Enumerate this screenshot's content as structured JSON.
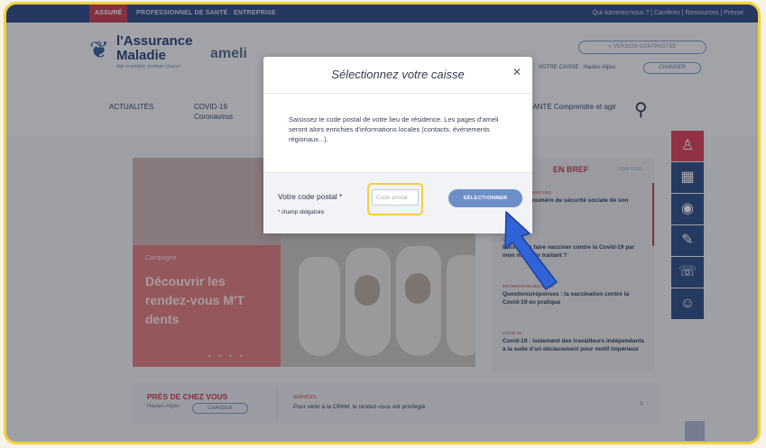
{
  "topbar": {
    "tabs": [
      "ASSURÉ",
      "PROFESSIONNEL DE SANTÉ",
      "ENTREPRISE"
    ],
    "links": [
      "Qui sommes-nous ?",
      "Carrières",
      "Ressources",
      "Presse"
    ]
  },
  "header": {
    "logo_line1": "l'Assurance",
    "logo_line2": "Maladie",
    "logo_tagline": "Agir ensemble, protéger chacun",
    "ameli": "ameli",
    "contrast_label": "VERSION CONTRASTÉE",
    "caisse_label": "VOTRE CAISSE : Hautes-Alpes",
    "changer_label": "CHANGER"
  },
  "nav": {
    "items": [
      "ACTUALITÉS",
      "COVID-19 Coronavirus",
      "SANTÉ Comprendre et agir"
    ]
  },
  "banner": {
    "campagne": "Campagne",
    "headline": "Découvrir les rendez-vous M'T dents"
  },
  "news": {
    "head": "EN BREF",
    "voir": "VOIR TOUS",
    "entries": [
      {
        "tag": "DROITS ET DÉMARCHES",
        "text": "Trouver le numéro de sécurité sociale de son enfant ?"
      },
      {
        "tag": "COVID-19",
        "text": "Puis-je me faire vacciner contre la Covid-19 par mon médecin traitant ?"
      },
      {
        "tag": "INFORMATION DES SOINS",
        "text": "Questions/réponses : la vaccination contre la Covid-19 en pratique"
      },
      {
        "tag": "COVID-19",
        "text": "Covid-19 : isolement des travailleurs indépendants à la suite d'un déclacement pour motif impérieux"
      }
    ]
  },
  "band": {
    "pres": "PRÈS DE CHEZ VOUS",
    "hautes": "Hautes-Alpes",
    "changer": "CHANGER",
    "small": "SERVICES",
    "msg": "Pour venir à la CPAM, le rendez-vous est privilégié"
  },
  "modal": {
    "title": "Sélectionnez votre caisse",
    "close": "✕",
    "description": "Saisissez le code postal de votre lieu de résidence. Les pages d'ameli seront alors enrichies d'informations locales (contacts, événements régionaux...).",
    "field_label": "Votre code postal *",
    "required_note": "* champ obligatoire",
    "input_placeholder": "Code postal",
    "input_value": "",
    "button_label": "SÉLECTIONNER"
  },
  "colors": {
    "brand_blue": "#2d4a86",
    "brand_red": "#c9364a",
    "highlight": "#f2cf38",
    "pointer_blue": "#2f63d6"
  }
}
